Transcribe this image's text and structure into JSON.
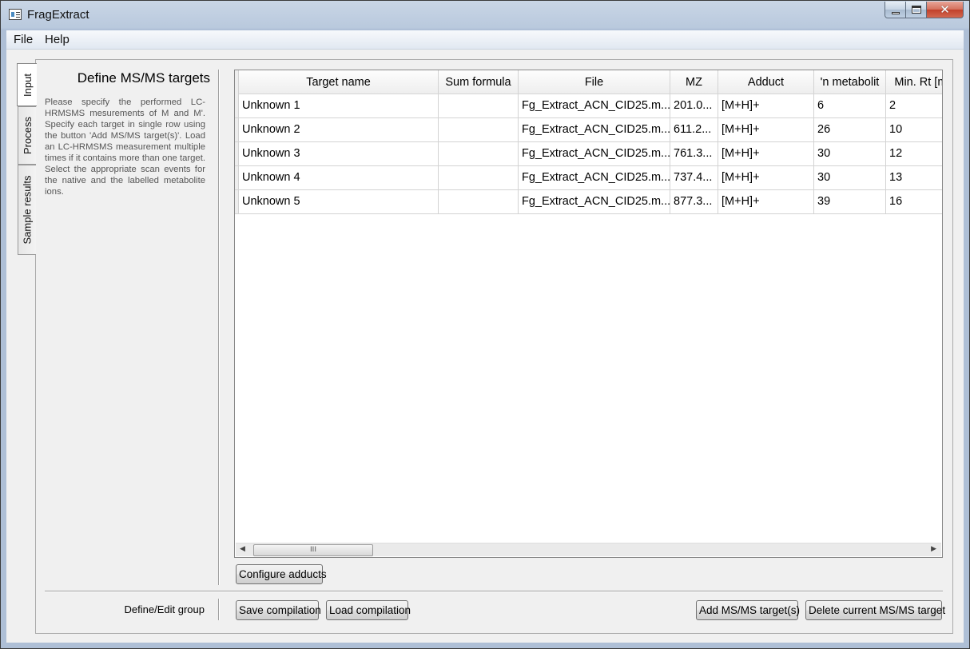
{
  "window": {
    "title": "FragExtract",
    "close_glyph": "✕"
  },
  "menu": {
    "items": [
      "File",
      "Help"
    ]
  },
  "tabs": [
    "Input",
    "Process",
    "Sample results"
  ],
  "left_panel": {
    "title": "Define MS/MS targets",
    "description": "Please specify the performed LC-HRMSMS mesurements of M and M'. Specify each target in single row using the button 'Add MS/MS target(s)'. Load an LC-HRMSMS measurement multiple times if it contains more than one target. Select the appropriate scan events for the native and the labelled metabolite ions."
  },
  "table": {
    "columns": [
      "Target name",
      "Sum formula",
      "File",
      "MZ",
      "Adduct",
      "'n metabolit",
      "Min. Rt [mi"
    ],
    "rows": [
      [
        "Unknown 1",
        "",
        "Fg_Extract_ACN_CID25.m...",
        "201.0...",
        "[M+H]+",
        "6",
        "2"
      ],
      [
        "Unknown 2",
        "",
        "Fg_Extract_ACN_CID25.m...",
        "611.2...",
        "[M+H]+",
        "26",
        "10"
      ],
      [
        "Unknown 3",
        "",
        "Fg_Extract_ACN_CID25.m...",
        "761.3...",
        "[M+H]+",
        "30",
        "12"
      ],
      [
        "Unknown 4",
        "",
        "Fg_Extract_ACN_CID25.m...",
        "737.4...",
        "[M+H]+",
        "30",
        "13"
      ],
      [
        "Unknown 5",
        "",
        "Fg_Extract_ACN_CID25.m...",
        "877.3...",
        "[M+H]+",
        "39",
        "16"
      ]
    ],
    "scroll": {
      "left_arrow": "◀",
      "right_arrow": "▶",
      "grip": "III"
    }
  },
  "buttons": {
    "configure_adducts": "Configure adducts",
    "save_compilation": "Save compilation",
    "load_compilation": "Load compilation",
    "add_target": "Add MS/MS target(s)",
    "delete_target": "Delete current MS/MS target"
  },
  "group_label": "Define/Edit group"
}
